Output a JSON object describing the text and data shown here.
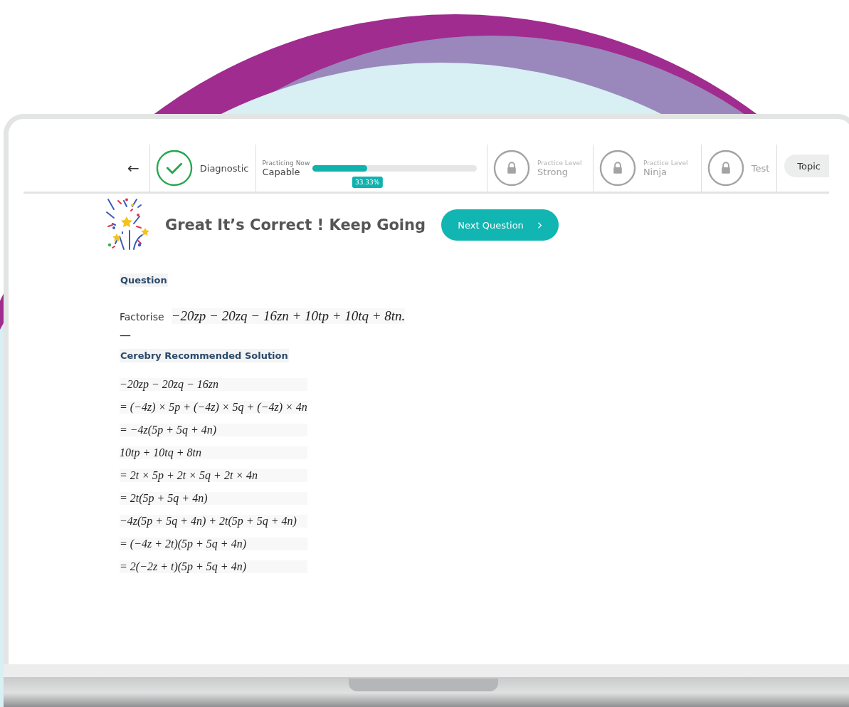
{
  "nav": {
    "back": "←",
    "steps": [
      {
        "kind": "done",
        "label": "Diagnostic"
      },
      {
        "kind": "current",
        "caption": "Practicing Now",
        "label": "Capable",
        "level": 0.3333,
        "reading": "33.33%"
      },
      {
        "kind": "locked",
        "caption": "Practice Level",
        "label": "Strong"
      },
      {
        "kind": "locked",
        "caption": "Practice Level",
        "label": "Ninja"
      },
      {
        "kind": "locked",
        "label": "Test"
      }
    ],
    "topic": "Topic"
  },
  "feedback": {
    "message": "Great It’s Correct ! Keep Going",
    "button": "Next Question"
  },
  "question": {
    "heading": "Question",
    "prompt": "Factorise",
    "expression": "−20zp − 20zq − 16zn + 10tp + 10tq + 8tn.",
    "separator": "—"
  },
  "solution": {
    "heading": "Cerebry Recommended Solution",
    "lines": [
      "−20zp − 20zq − 16zn",
      "= (−4z) × 5p + (−4z) × 5q + (−4z) × 4n",
      "= −4z(5p + 5q + 4n)",
      "10tp + 10tq + 8tn",
      "= 2t × 5p + 2t × 5q + 2t × 4n",
      "= 2t(5p + 5q + 4n)",
      "−4z(5p + 5q + 4n) + 2t(5p + 5q + 4n)",
      "= (−4z + 2t)(5p + 5q + 4n)",
      "= 2(−2z + t)(5p + 5q + 4n)"
    ]
  }
}
